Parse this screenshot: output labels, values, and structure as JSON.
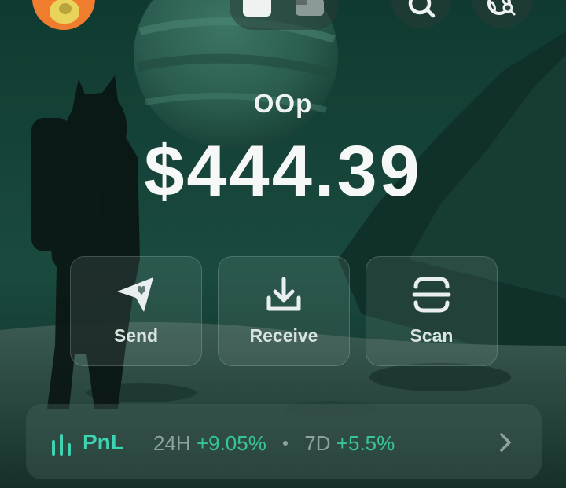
{
  "header": {
    "avatar_icon": "yellow-coin-avatar-icon",
    "view_toggle": [
      "grid-view-icon",
      "list-view-icon"
    ],
    "search_icon": "search-icon",
    "explore_icon": "globe-search-icon"
  },
  "token": {
    "name": "OOp",
    "balance": "$444.39"
  },
  "actions": [
    {
      "label": "Send",
      "icon": "send-arrow-icon"
    },
    {
      "label": "Receive",
      "icon": "download-tray-icon"
    },
    {
      "label": "Scan",
      "icon": "scan-frame-icon"
    }
  ],
  "pnl": {
    "title": "PnL",
    "period1": "24H",
    "change1": "+9.05%",
    "period2": "7D",
    "change2": "+5.5%",
    "accent_color": "#3ed3b1",
    "positive_color": "#35c596"
  }
}
